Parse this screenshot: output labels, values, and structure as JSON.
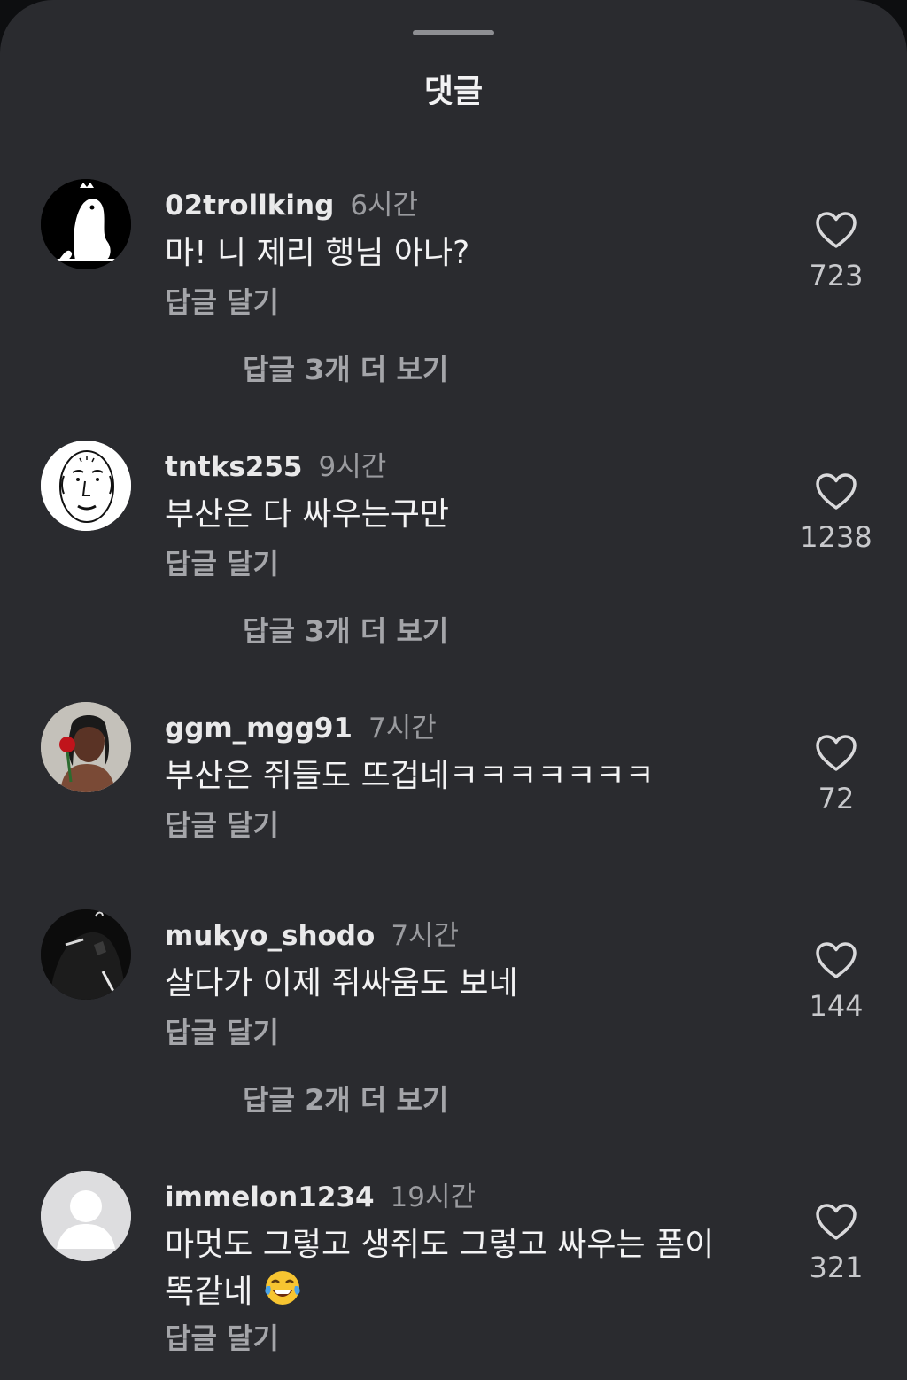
{
  "sheet": {
    "title": "댓글"
  },
  "comments": [
    {
      "username": "02trollking",
      "time": "6시간",
      "text": "마! 니 제리 행님 아나?",
      "reply_label": "답글 달기",
      "likes": "723",
      "more_replies": "답글 3개 더 보기"
    },
    {
      "username": "tntks255",
      "time": "9시간",
      "text": "부산은 다 싸우는구만",
      "reply_label": "답글 달기",
      "likes": "1238",
      "more_replies": "답글 3개 더 보기"
    },
    {
      "username": "ggm_mgg91",
      "time": "7시간",
      "text": "부산은 쥐들도 뜨겁네ㅋㅋㅋㅋㅋㅋㅋ",
      "reply_label": "답글 달기",
      "likes": "72"
    },
    {
      "username": "mukyo_shodo",
      "time": "7시간",
      "text": "살다가 이제 쥐싸움도 보네",
      "reply_label": "답글 달기",
      "likes": "144",
      "more_replies": "답글 2개 더 보기"
    },
    {
      "username": "immelon1234",
      "time": "19시간",
      "text_line1": "마멋도 그렇고 생쥐도 그렇고 싸우는 폼이",
      "text_line2": "똑같네",
      "emoji": "tears-of-joy-emoji",
      "reply_label": "답글 달기",
      "likes": "321"
    }
  ],
  "colors": {
    "sheet_bg": "#2a2b2f",
    "text_primary": "#f3f3f4",
    "text_secondary": "#a4a5a9",
    "heart_outline": "#d9d9db"
  }
}
